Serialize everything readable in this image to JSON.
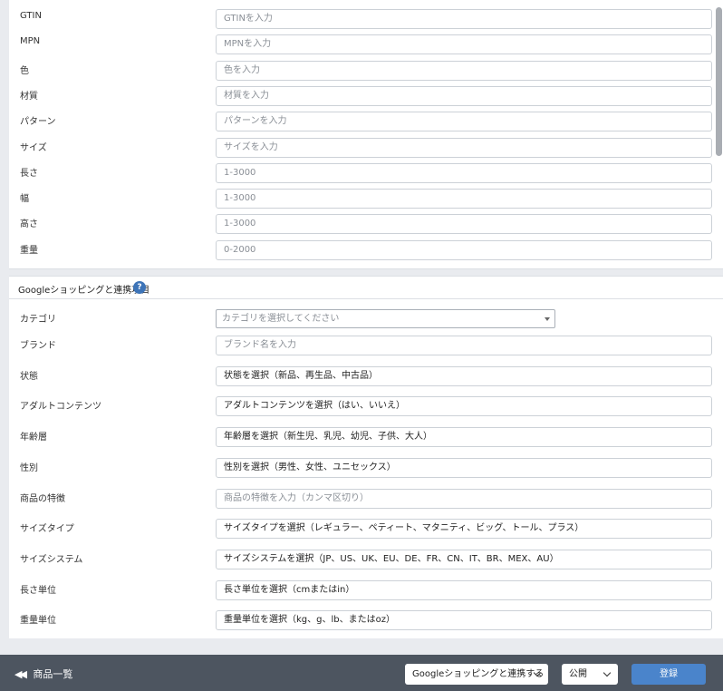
{
  "top_fields": [
    {
      "label": "GTIN",
      "text": "GTINを入力",
      "kind": "placeholder"
    },
    {
      "label": "MPN",
      "text": "MPNを入力",
      "kind": "placeholder"
    },
    {
      "label": "色",
      "text": "色を入力",
      "kind": "placeholder"
    },
    {
      "label": "材質",
      "text": "材質を入力",
      "kind": "placeholder"
    },
    {
      "label": "パターン",
      "text": "パターンを入力",
      "kind": "placeholder"
    },
    {
      "label": "サイズ",
      "text": "サイズを入力",
      "kind": "placeholder"
    },
    {
      "label": "長さ",
      "text": "1-3000",
      "kind": "placeholder"
    },
    {
      "label": "幅",
      "text": "1-3000",
      "kind": "placeholder"
    },
    {
      "label": "高さ",
      "text": "1-3000",
      "kind": "placeholder"
    },
    {
      "label": "重量",
      "text": "0-2000",
      "kind": "placeholder"
    }
  ],
  "google_section": {
    "title": "Googleショッピングと連携項目",
    "help_icon": "?",
    "category": {
      "label": "カテゴリ",
      "placeholder": "カテゴリを選択してください"
    },
    "fields": [
      {
        "label": "ブランド",
        "text": "ブランド名を入力",
        "kind": "placeholder"
      },
      {
        "label": "状態",
        "text": "状態を選択（新品、再生品、中古品）",
        "kind": "value"
      },
      {
        "label": "アダルトコンテンツ",
        "text": "アダルトコンテンツを選択（はい、いいえ）",
        "kind": "value"
      },
      {
        "label": "年齢層",
        "text": "年齢層を選択（新生児、乳児、幼児、子供、大人）",
        "kind": "value"
      },
      {
        "label": "性別",
        "text": "性別を選択（男性、女性、ユニセックス）",
        "kind": "value"
      },
      {
        "label": "商品の特徴",
        "text": "商品の特徴を入力（カンマ区切り）",
        "kind": "placeholder"
      },
      {
        "label": "サイズタイプ",
        "text": "サイズタイプを選択（レギュラー、ペティート、マタニティ、ビッグ、トール、プラス）",
        "kind": "value"
      },
      {
        "label": "サイズシステム",
        "text": "サイズシステムを選択（JP、US、UK、EU、DE、FR、CN、IT、BR、MEX、AU）",
        "kind": "value"
      },
      {
        "label": "長さ単位",
        "text": "長さ単位を選択（cmまたはin）",
        "kind": "value"
      },
      {
        "label": "重量単位",
        "text": "重量単位を選択（kg、g、lb、またはoz）",
        "kind": "value"
      }
    ]
  },
  "footer": {
    "back_label": "商品一覧",
    "back_icon": "double-left-arrow-icon",
    "google_dropdown": "Googleショッピングと連携する",
    "status_dropdown": "公開",
    "submit_label": "登録"
  },
  "colors": {
    "footer_bg": "#4d5560",
    "primary_button": "#4a84cb",
    "help_icon": "#3d74b8"
  }
}
